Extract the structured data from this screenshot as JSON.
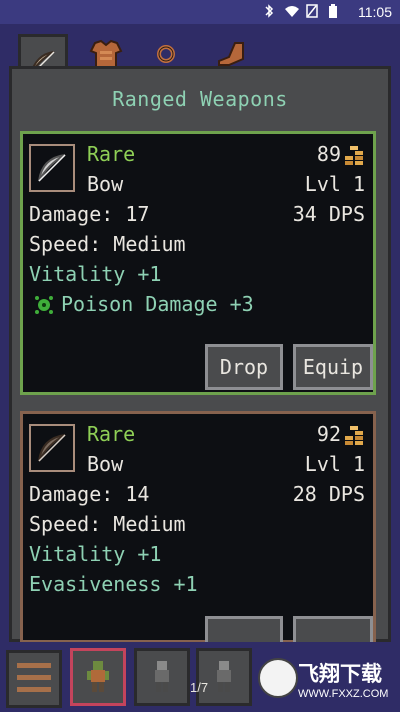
{
  "status_bar": {
    "time": "11:05",
    "icons": [
      "bluetooth-icon",
      "wifi-icon",
      "no-sim-icon",
      "battery-icon"
    ]
  },
  "tabs": [
    {
      "name": "ranged-weapons",
      "icon": "bow-icon",
      "active": true
    },
    {
      "name": "armor",
      "icon": "chest-armor-icon",
      "active": false
    },
    {
      "name": "rings",
      "icon": "ring-icon",
      "active": false
    },
    {
      "name": "boots",
      "icon": "boot-icon",
      "active": false
    }
  ],
  "panel": {
    "title": "Ranged Weapons"
  },
  "items": [
    {
      "rarity": "Rare",
      "type": "Bow",
      "price": "89",
      "level": "Lvl 1",
      "damage": "Damage: 17",
      "dps": "34 DPS",
      "speed": "Speed: Medium",
      "bonus1": "Vitality +1",
      "bonus2": "Poison Damage +3",
      "bonus2_icon": "poison-icon",
      "drop_label": "Drop",
      "equip_label": "Equip",
      "rarity_color": "#8fcf56",
      "border_color": "#6ea24d"
    },
    {
      "rarity": "Rare",
      "type": "Bow",
      "price": "92",
      "level": "Lvl 1",
      "damage": "Damage: 14",
      "dps": "28 DPS",
      "speed": "Speed: Medium",
      "bonus1": "Vitality +1",
      "bonus2": "Evasiveness +1",
      "border_color": "#86624e"
    }
  ],
  "bottom_bar": {
    "page_indicator": "1/7",
    "watermark_title": "飞翔下载",
    "watermark_url": "WWW.FXXZ.COM"
  },
  "colors": {
    "background": "#2f2c66",
    "panel": "#4a4b4d",
    "card": "#0d0f13",
    "bonus_text": "#8ed1b3",
    "text": "#e9e6e0"
  }
}
